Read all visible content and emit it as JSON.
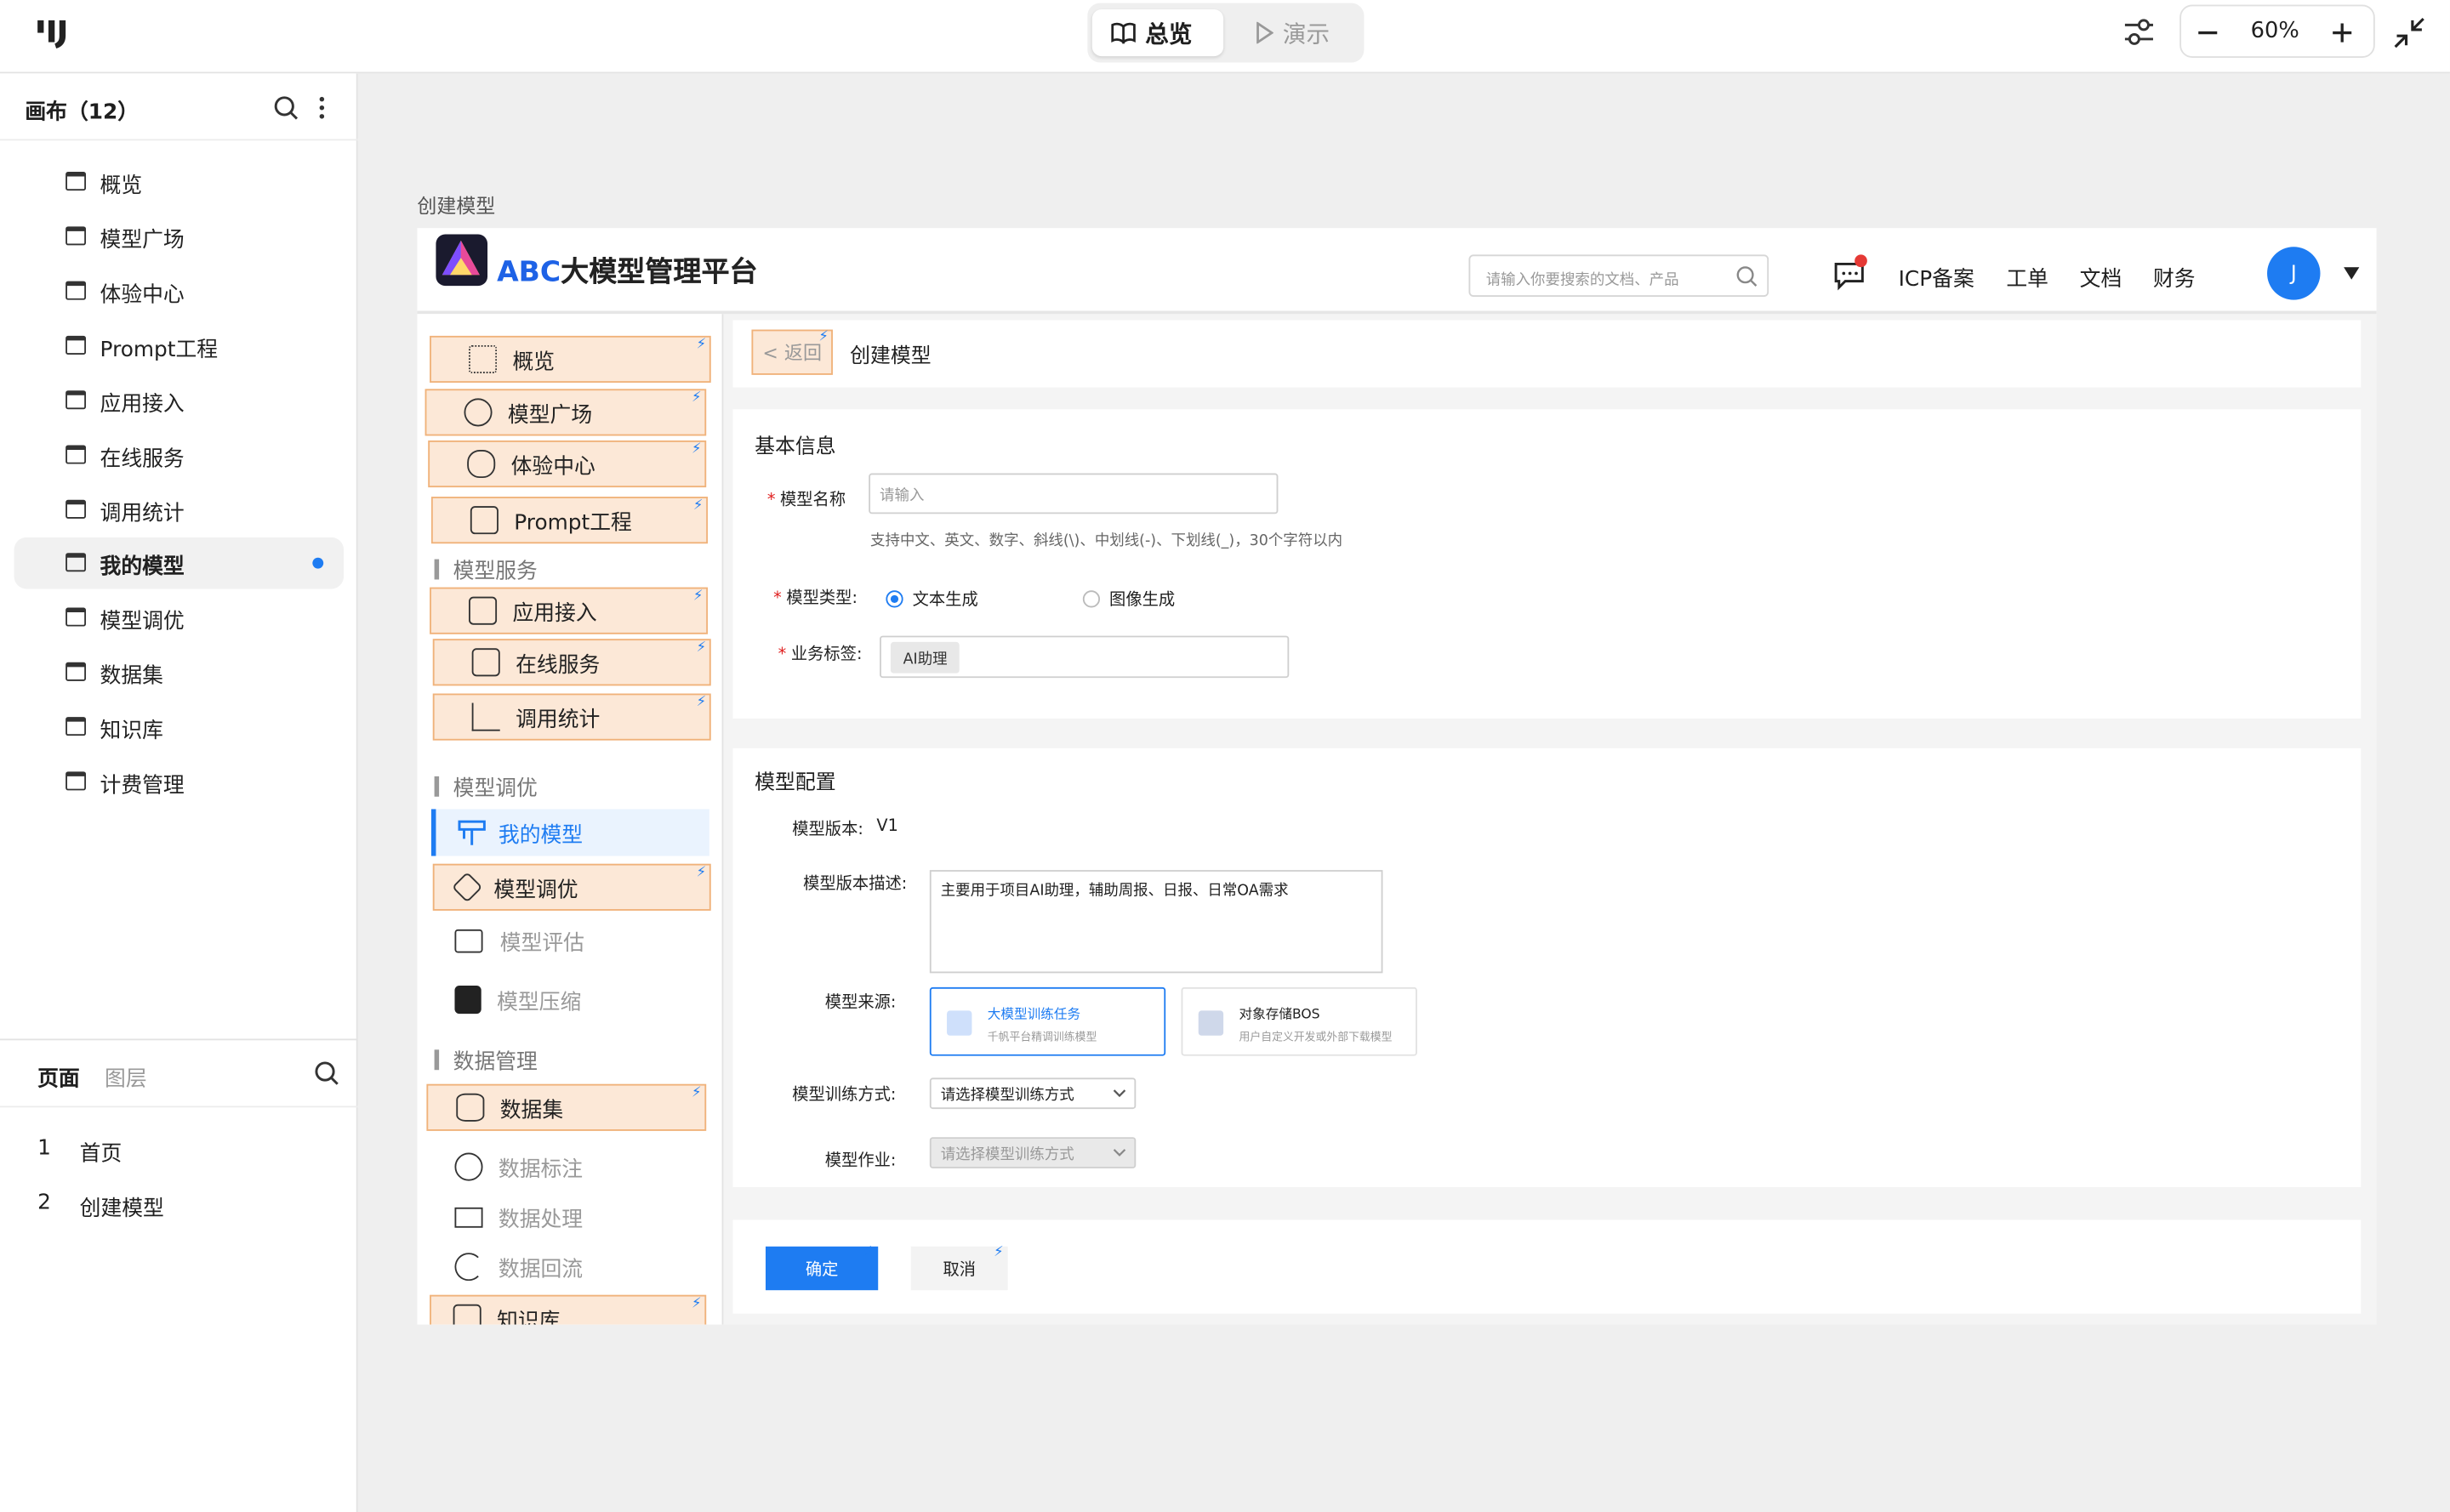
{
  "toolbar": {
    "overview_label": "总览",
    "present_label": "演示",
    "zoom_value": "60%"
  },
  "left": {
    "canvas_title": "画布（12）",
    "canvases": [
      {
        "label": "概览"
      },
      {
        "label": "模型广场"
      },
      {
        "label": "体验中心"
      },
      {
        "label": "Prompt工程"
      },
      {
        "label": "应用接入"
      },
      {
        "label": "在线服务"
      },
      {
        "label": "调用统计"
      },
      {
        "label": "我的模型"
      },
      {
        "label": "模型调优"
      },
      {
        "label": "数据集"
      },
      {
        "label": "知识库"
      },
      {
        "label": "计费管理"
      }
    ],
    "tab_pages": "页面",
    "tab_layers": "图层",
    "pages": [
      {
        "num": "1",
        "label": "首页"
      },
      {
        "num": "2",
        "label": "创建模型"
      }
    ]
  },
  "artboard": {
    "title": "创建模型",
    "header": {
      "brand_abc": "ABC",
      "brand_rest": "大模型管理平台",
      "search_placeholder": "请输入你要搜索的文档、产品",
      "nav": [
        "ICP备案",
        "工单",
        "文档",
        "财务"
      ],
      "avatar_letter": "J"
    },
    "sidebar": {
      "items": {
        "overview": "概览",
        "square": "模型广场",
        "experience": "体验中心",
        "prompt": "Prompt工程",
        "group_service": "模型服务",
        "app_access": "应用接入",
        "online": "在线服务",
        "stats": "调用统计",
        "group_tuning": "模型调优",
        "my_models": "我的模型",
        "tuning": "模型调优",
        "eval": "模型评估",
        "compress": "模型压缩",
        "group_data": "数据管理",
        "dataset": "数据集",
        "annotate": "数据标注",
        "process": "数据处理",
        "backflow": "数据回流",
        "knowledge": "知识库"
      }
    },
    "page": {
      "back_label": "< 返回",
      "title": "创建模型",
      "basic_title": "基本信息",
      "name_label": "模型名称",
      "name_placeholder": "请输入",
      "name_hint": "支持中文、英文、数字、斜线(\\)、中划线(-)、下划线(_)，30个字符以内",
      "type_label": "模型类型:",
      "type_text": "文本生成",
      "type_image": "图像生成",
      "tag_label": "业务标签:",
      "tag_value": "AI助理",
      "config_title": "模型配置",
      "version_label": "模型版本:",
      "version_value": "V1",
      "desc_label": "模型版本描述:",
      "desc_value": "主要用于项目AI助理，辅助周报、日报、日常OA需求",
      "source_label": "模型来源:",
      "source1_title": "大模型训练任务",
      "source1_sub": "千帆平台精调训练模型",
      "source2_title": "对象存储BOS",
      "source2_sub": "用户自定义开发或外部下载模型",
      "train_label": "模型训练方式:",
      "train_placeholder": "请选择模型训练方式",
      "job_label": "模型作业:",
      "job_placeholder": "请选择模型训练方式",
      "confirm": "确定",
      "cancel": "取消"
    }
  },
  "colors": {
    "accent": "#1e7cf2",
    "nav_highlight_bg": "#fce8d7",
    "nav_highlight_border": "#f0b27a",
    "notify_dot": "#e53935"
  }
}
